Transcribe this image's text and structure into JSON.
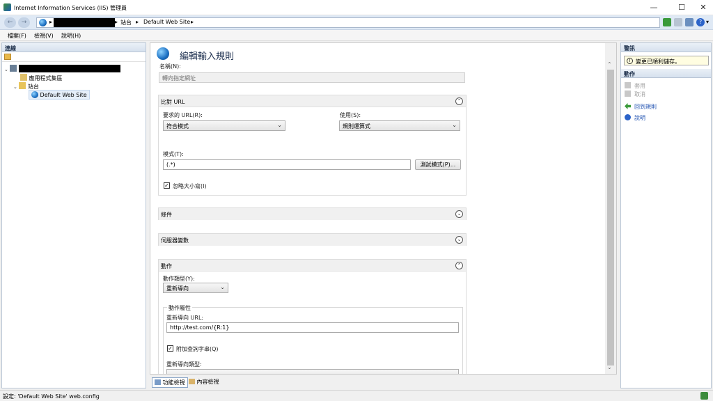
{
  "window": {
    "title": "Internet Information Services (IIS) 管理員",
    "minimize": "—",
    "maximize": "☐",
    "close": "✕"
  },
  "address": {
    "back": "←",
    "forward": "→",
    "crumbs": [
      "站台",
      "Default Web Site"
    ],
    "separator": "▸",
    "help_icon": "?",
    "help_dropdown": "▾"
  },
  "menu": {
    "items": [
      "檔案(F)",
      "檢視(V)",
      "說明(H)"
    ]
  },
  "connections": {
    "header": "連線",
    "tree": [
      {
        "label": "應用程式集區"
      },
      {
        "label": "站台"
      },
      {
        "label": "Default Web Site"
      }
    ]
  },
  "editor": {
    "title": "編輯輸入規則",
    "name_label": "名稱(N):",
    "name_value": "轉向指定網址",
    "match": {
      "header": "比對 URL",
      "requested_label": "要求的 URL(R):",
      "requested_value": "符合模式",
      "using_label": "使用(S):",
      "using_value": "規則運算式",
      "pattern_label": "模式(T):",
      "pattern_value": "(.*)",
      "test_button": "測試模式(P)...",
      "ignore_case_label": "忽略大小寫(I)",
      "ignore_case_checked": true
    },
    "conditions_header": "條件",
    "server_vars_header": "伺服器變數",
    "action": {
      "header": "動作",
      "type_label": "動作類型(Y):",
      "type_value": "重新導向",
      "properties_label": "動作屬性",
      "redirect_url_label": "重新導向 URL:",
      "redirect_url_value": "http://test.com/{R:1}",
      "append_query_label": "附加查詢字串(Q)",
      "append_query_checked": true,
      "redirect_type_label": "重新導向類型:"
    },
    "collapse_up": "⌃",
    "expand_down": "⌄",
    "scroll_up": "⌃",
    "scroll_down": "⌄"
  },
  "bottom_tabs": [
    "功能檢視",
    "內容檢視"
  ],
  "alerts": {
    "header": "警訊",
    "message": "變更已順利儲存。",
    "icon": "i"
  },
  "actions": {
    "header": "動作",
    "items": [
      {
        "label": "套用",
        "enabled": false
      },
      {
        "label": "取消",
        "enabled": false
      },
      {
        "label": "回到規則",
        "enabled": true
      },
      {
        "label": "說明",
        "enabled": true
      }
    ]
  },
  "status": {
    "text": "設定: 'Default Web Site' web.config"
  },
  "colors": {
    "accent": "#1e50b0",
    "header_bg": "#dfe9f5",
    "alert_bg": "#fffde1"
  }
}
